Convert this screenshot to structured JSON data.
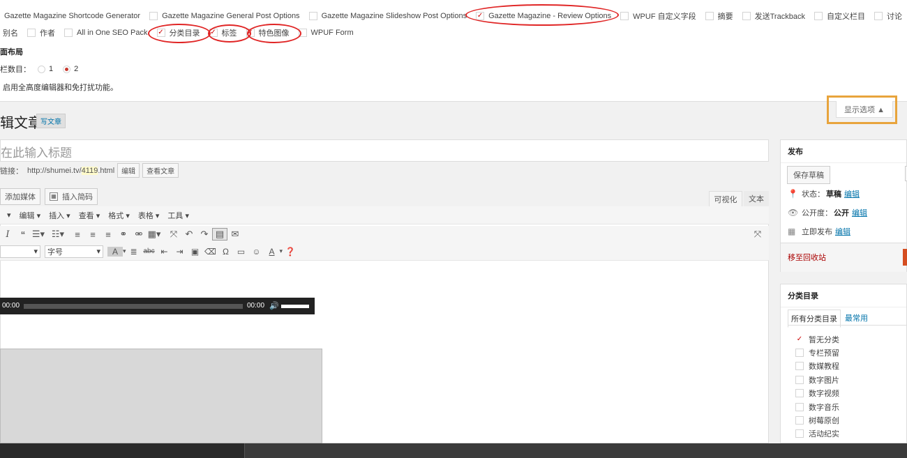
{
  "screen_options": {
    "modules_row1": [
      {
        "label": "Gazette Magazine Shortcode Generator",
        "checked": false
      },
      {
        "label": "Gazette Magazine General Post Options",
        "checked": false
      },
      {
        "label": "Gazette Magazine Slideshow Post Options",
        "checked": false
      },
      {
        "label": "Gazette Magazine - Review Options",
        "checked": true
      },
      {
        "label": "WPUF 自定义字段",
        "checked": false
      },
      {
        "label": "摘要",
        "checked": false
      },
      {
        "label": "发送Trackback",
        "checked": false
      },
      {
        "label": "自定义栏目",
        "checked": false
      },
      {
        "label": "讨论",
        "checked": false
      }
    ],
    "modules_row2": [
      {
        "label": "别名",
        "checked": false
      },
      {
        "label": "作者",
        "checked": false
      },
      {
        "label": "All in One SEO Pack",
        "checked": false
      },
      {
        "label": "分类目录",
        "checked": true
      },
      {
        "label": "标签",
        "checked": true
      },
      {
        "label": "特色图像",
        "checked": true
      },
      {
        "label": "WPUF Form",
        "checked": false
      }
    ],
    "layout_title": "面布局",
    "columns_label": "栏数目：",
    "column_options": [
      "1",
      "2"
    ],
    "column_selected": "2",
    "fullheight_label": "启用全高度编辑器和免打扰功能。",
    "toggle_button": "显示选项 ▲"
  },
  "header": {
    "title": "辑文章",
    "add_new": "写文章"
  },
  "post": {
    "title_placeholder": "在此输入标题",
    "permalink_label": "链接：",
    "permalink_base": "http://shumei.tv/",
    "permalink_id": "4119",
    "permalink_ext": ".html",
    "edit_btn": "编辑",
    "view_btn": "查看文章"
  },
  "media": {
    "add_media": "添加媒体",
    "insert_code": "插入简码"
  },
  "editor_tabs": {
    "visual": "可视化",
    "text": "文本"
  },
  "menubar": [
    "编辑 ▾",
    "插入 ▾",
    "查看 ▾",
    "格式 ▾",
    "表格 ▾",
    "工具 ▾"
  ],
  "toolbar": {
    "font_size_label": "字号"
  },
  "audio_player": {
    "current": "00:00",
    "duration": "00:00"
  },
  "publish": {
    "title": "发布",
    "save_draft": "保存草稿",
    "status_label": "状态：",
    "status_value": "草稿",
    "status_edit": "编辑",
    "visibility_label": "公开度：",
    "visibility_value": "公开",
    "visibility_edit": "编辑",
    "schedule_label": "立即发布",
    "schedule_edit": "编辑",
    "trash": "移至回收站"
  },
  "categories": {
    "title": "分类目录",
    "tab_all": "所有分类目录",
    "tab_popular": "最常用",
    "items": [
      {
        "label": "暂无分类",
        "checked": true
      },
      {
        "label": "专栏预留",
        "checked": false
      },
      {
        "label": "数媒教程",
        "checked": false
      },
      {
        "label": "数字图片",
        "checked": false
      },
      {
        "label": "数字视频",
        "checked": false
      },
      {
        "label": "数字音乐",
        "checked": false
      },
      {
        "label": "树莓原创",
        "checked": false
      },
      {
        "label": "活动纪实",
        "checked": false
      }
    ]
  }
}
